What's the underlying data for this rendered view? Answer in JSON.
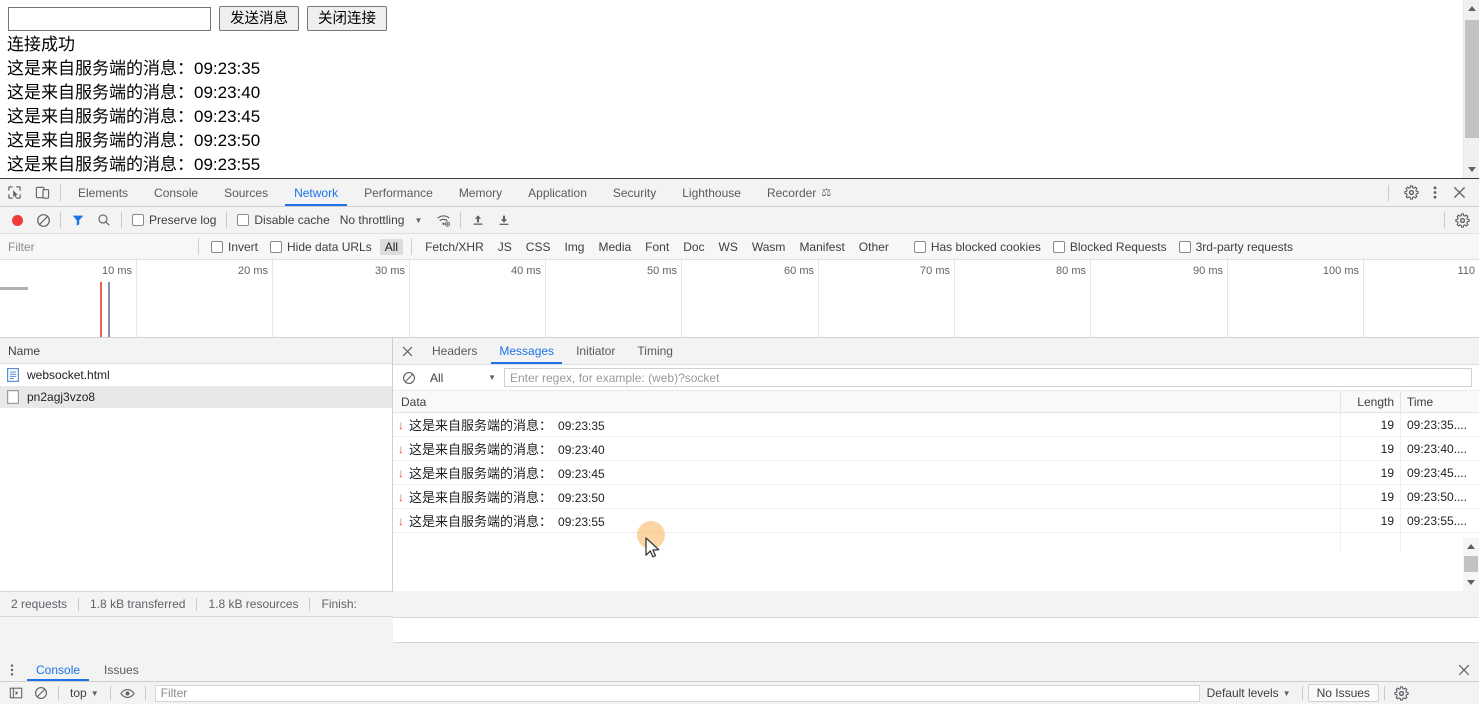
{
  "page": {
    "input_value": "",
    "input_placeholder": "",
    "send_button": "发送消息",
    "close_button": "关闭连接",
    "log": [
      {
        "text": "连接成功",
        "time": ""
      },
      {
        "text": "这是来自服务端的消息：",
        "time": "09:23:35"
      },
      {
        "text": "这是来自服务端的消息：",
        "time": "09:23:40"
      },
      {
        "text": "这是来自服务端的消息：",
        "time": "09:23:45"
      },
      {
        "text": "这是来自服务端的消息：",
        "time": "09:23:50"
      },
      {
        "text": "这是来自服务端的消息：",
        "time": "09:23:55"
      }
    ]
  },
  "devtools": {
    "tabs": [
      {
        "label": "Elements",
        "active": false
      },
      {
        "label": "Console",
        "active": false
      },
      {
        "label": "Sources",
        "active": false
      },
      {
        "label": "Network",
        "active": true
      },
      {
        "label": "Performance",
        "active": false
      },
      {
        "label": "Memory",
        "active": false
      },
      {
        "label": "Application",
        "active": false
      },
      {
        "label": "Security",
        "active": false
      },
      {
        "label": "Lighthouse",
        "active": false
      },
      {
        "label": "Recorder",
        "active": false
      }
    ],
    "recorder_badge": "⛏",
    "accent_color": "#1a73e8",
    "record_color": "#ee3b3b"
  },
  "network_toolbar": {
    "preserve_log": {
      "label": "Preserve log",
      "checked": false
    },
    "disable_cache": {
      "label": "Disable cache",
      "checked": false
    },
    "throttling": "No throttling"
  },
  "filter_bar": {
    "filter_placeholder": "Filter",
    "filter_value": "",
    "invert": {
      "label": "Invert",
      "checked": false
    },
    "hide_data_urls": {
      "label": "Hide data URLs",
      "checked": false
    },
    "types": [
      "All",
      "Fetch/XHR",
      "JS",
      "CSS",
      "Img",
      "Media",
      "Font",
      "Doc",
      "WS",
      "Wasm",
      "Manifest",
      "Other"
    ],
    "selected_type": "All",
    "has_blocked_cookies": {
      "label": "Has blocked cookies",
      "checked": false
    },
    "blocked_requests": {
      "label": "Blocked Requests",
      "checked": false
    },
    "third_party": {
      "label": "3rd-party requests",
      "checked": false
    }
  },
  "overview": {
    "ticks": [
      "10 ms",
      "20 ms",
      "30 ms",
      "40 ms",
      "50 ms",
      "60 ms",
      "70 ms",
      "80 ms",
      "90 ms",
      "100 ms",
      "110"
    ],
    "dclevent_color": "#1a6fe0",
    "loadevent_color": "#e8614c"
  },
  "requests": {
    "header": "Name",
    "rows": [
      {
        "name": "websocket.html",
        "icon": "document-icon",
        "selected": false
      },
      {
        "name": "pn2agj3vzo8",
        "icon": "websocket-icon",
        "selected": true
      }
    ]
  },
  "detail": {
    "tabs": [
      {
        "label": "Headers",
        "active": false
      },
      {
        "label": "Messages",
        "active": true
      },
      {
        "label": "Initiator",
        "active": false
      },
      {
        "label": "Timing",
        "active": false
      }
    ],
    "filter_select": "All",
    "regex_placeholder": "Enter regex, for example: (web)?socket",
    "regex_value": "",
    "columns": {
      "data": "Data",
      "length": "Length",
      "time": "Time"
    },
    "messages": [
      {
        "direction": "in",
        "text": "这是来自服务端的消息：",
        "time_in_text": "09:23:35",
        "length": "19",
        "time": "09:23:35...."
      },
      {
        "direction": "in",
        "text": "这是来自服务端的消息：",
        "time_in_text": "09:23:40",
        "length": "19",
        "time": "09:23:40...."
      },
      {
        "direction": "in",
        "text": "这是来自服务端的消息：",
        "time_in_text": "09:23:45",
        "length": "19",
        "time": "09:23:45...."
      },
      {
        "direction": "in",
        "text": "这是来自服务端的消息：",
        "time_in_text": "09:23:50",
        "length": "19",
        "time": "09:23:50...."
      },
      {
        "direction": "in",
        "text": "这是来自服务端的消息：",
        "time_in_text": "09:23:55",
        "length": "19",
        "time": "09:23:55...."
      }
    ],
    "inbound_arrow": "↓",
    "inbound_color": "#e8452f"
  },
  "network_status": {
    "requests": "2 requests",
    "transferred": "1.8 kB transferred",
    "resources": "1.8 kB resources",
    "finish": "Finish:"
  },
  "drawer": {
    "tabs": [
      {
        "label": "Console",
        "active": true
      },
      {
        "label": "Issues",
        "active": false
      }
    ],
    "context": "top",
    "filter_placeholder": "Filter",
    "filter_value": "",
    "levels": "Default levels",
    "issues": "No Issues"
  }
}
